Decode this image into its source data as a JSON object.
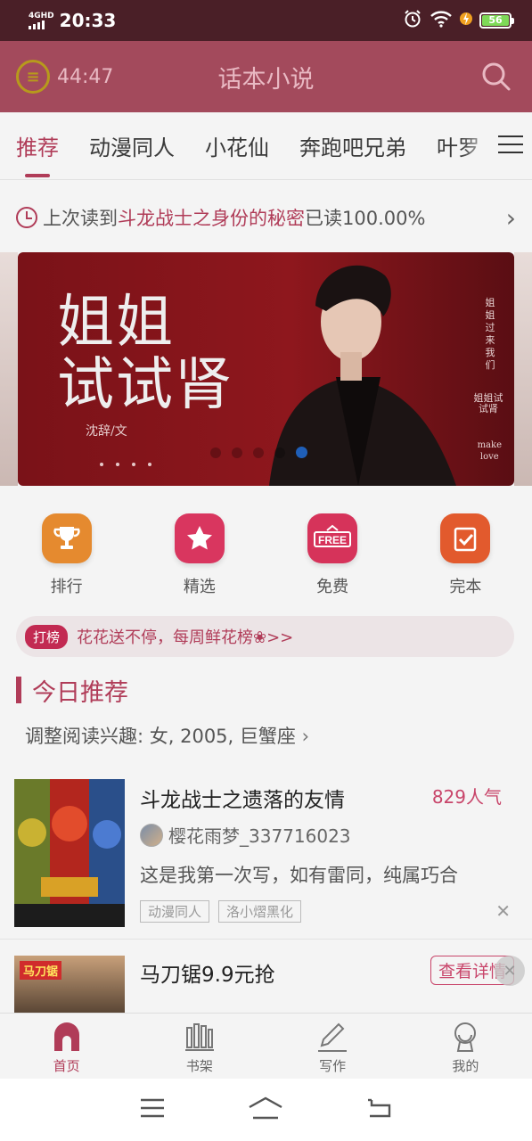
{
  "status_bar": {
    "network": "4GHD",
    "time": "20:33",
    "battery": "56"
  },
  "header": {
    "timer": "44:47",
    "title": "话本小说"
  },
  "tabs": [
    "推荐",
    "动漫同人",
    "小花仙",
    "奔跑吧兄弟",
    "叶罗"
  ],
  "last_read": {
    "prefix": "上次读到",
    "book": "斗龙战士之身份的秘密",
    "suffix": "已读100.00%"
  },
  "banner": {
    "title_line1": "姐姐",
    "title_line2": "试试肾",
    "author": "沈辞/文",
    "vertical_text": "姐姐过来我们",
    "mini_title": "姐姐试试肾",
    "make": "make",
    "love": "love"
  },
  "quick_links": [
    {
      "label": "排行",
      "icon": "trophy-icon",
      "color": "#e58a2f"
    },
    {
      "label": "精选",
      "icon": "star-icon",
      "color": "#d9365f"
    },
    {
      "label": "免费",
      "icon": "free-icon",
      "color": "#d6335a"
    },
    {
      "label": "完本",
      "icon": "check-icon",
      "color": "#e25a2d"
    }
  ],
  "promo": {
    "badge": "打榜",
    "text": "花花送不停，每周鲜花榜❀>>"
  },
  "section": {
    "title": "今日推荐",
    "interest": "调整阅读兴趣: 女, 2005, 巨蟹座"
  },
  "book": {
    "title": "斗龙战士之遗落的友情",
    "popularity": "829人气",
    "author": "樱花雨梦_337716023",
    "desc": "这是我第一次写，如有雷同，纯属巧合",
    "tags": [
      "动漫同人",
      "洛小熠黑化"
    ]
  },
  "ad": {
    "image_text": "马刀锯",
    "title": "马刀锯9.9元抢",
    "detail_btn": "查看详情"
  },
  "bottom_nav": [
    {
      "label": "首页",
      "icon": "home-icon"
    },
    {
      "label": "书架",
      "icon": "bookshelf-icon"
    },
    {
      "label": "写作",
      "icon": "pen-icon"
    },
    {
      "label": "我的",
      "icon": "profile-icon"
    }
  ],
  "colors": {
    "accent": "#b03c58",
    "header_bg": "#a34a5c",
    "status_bg": "#4a1f27"
  }
}
